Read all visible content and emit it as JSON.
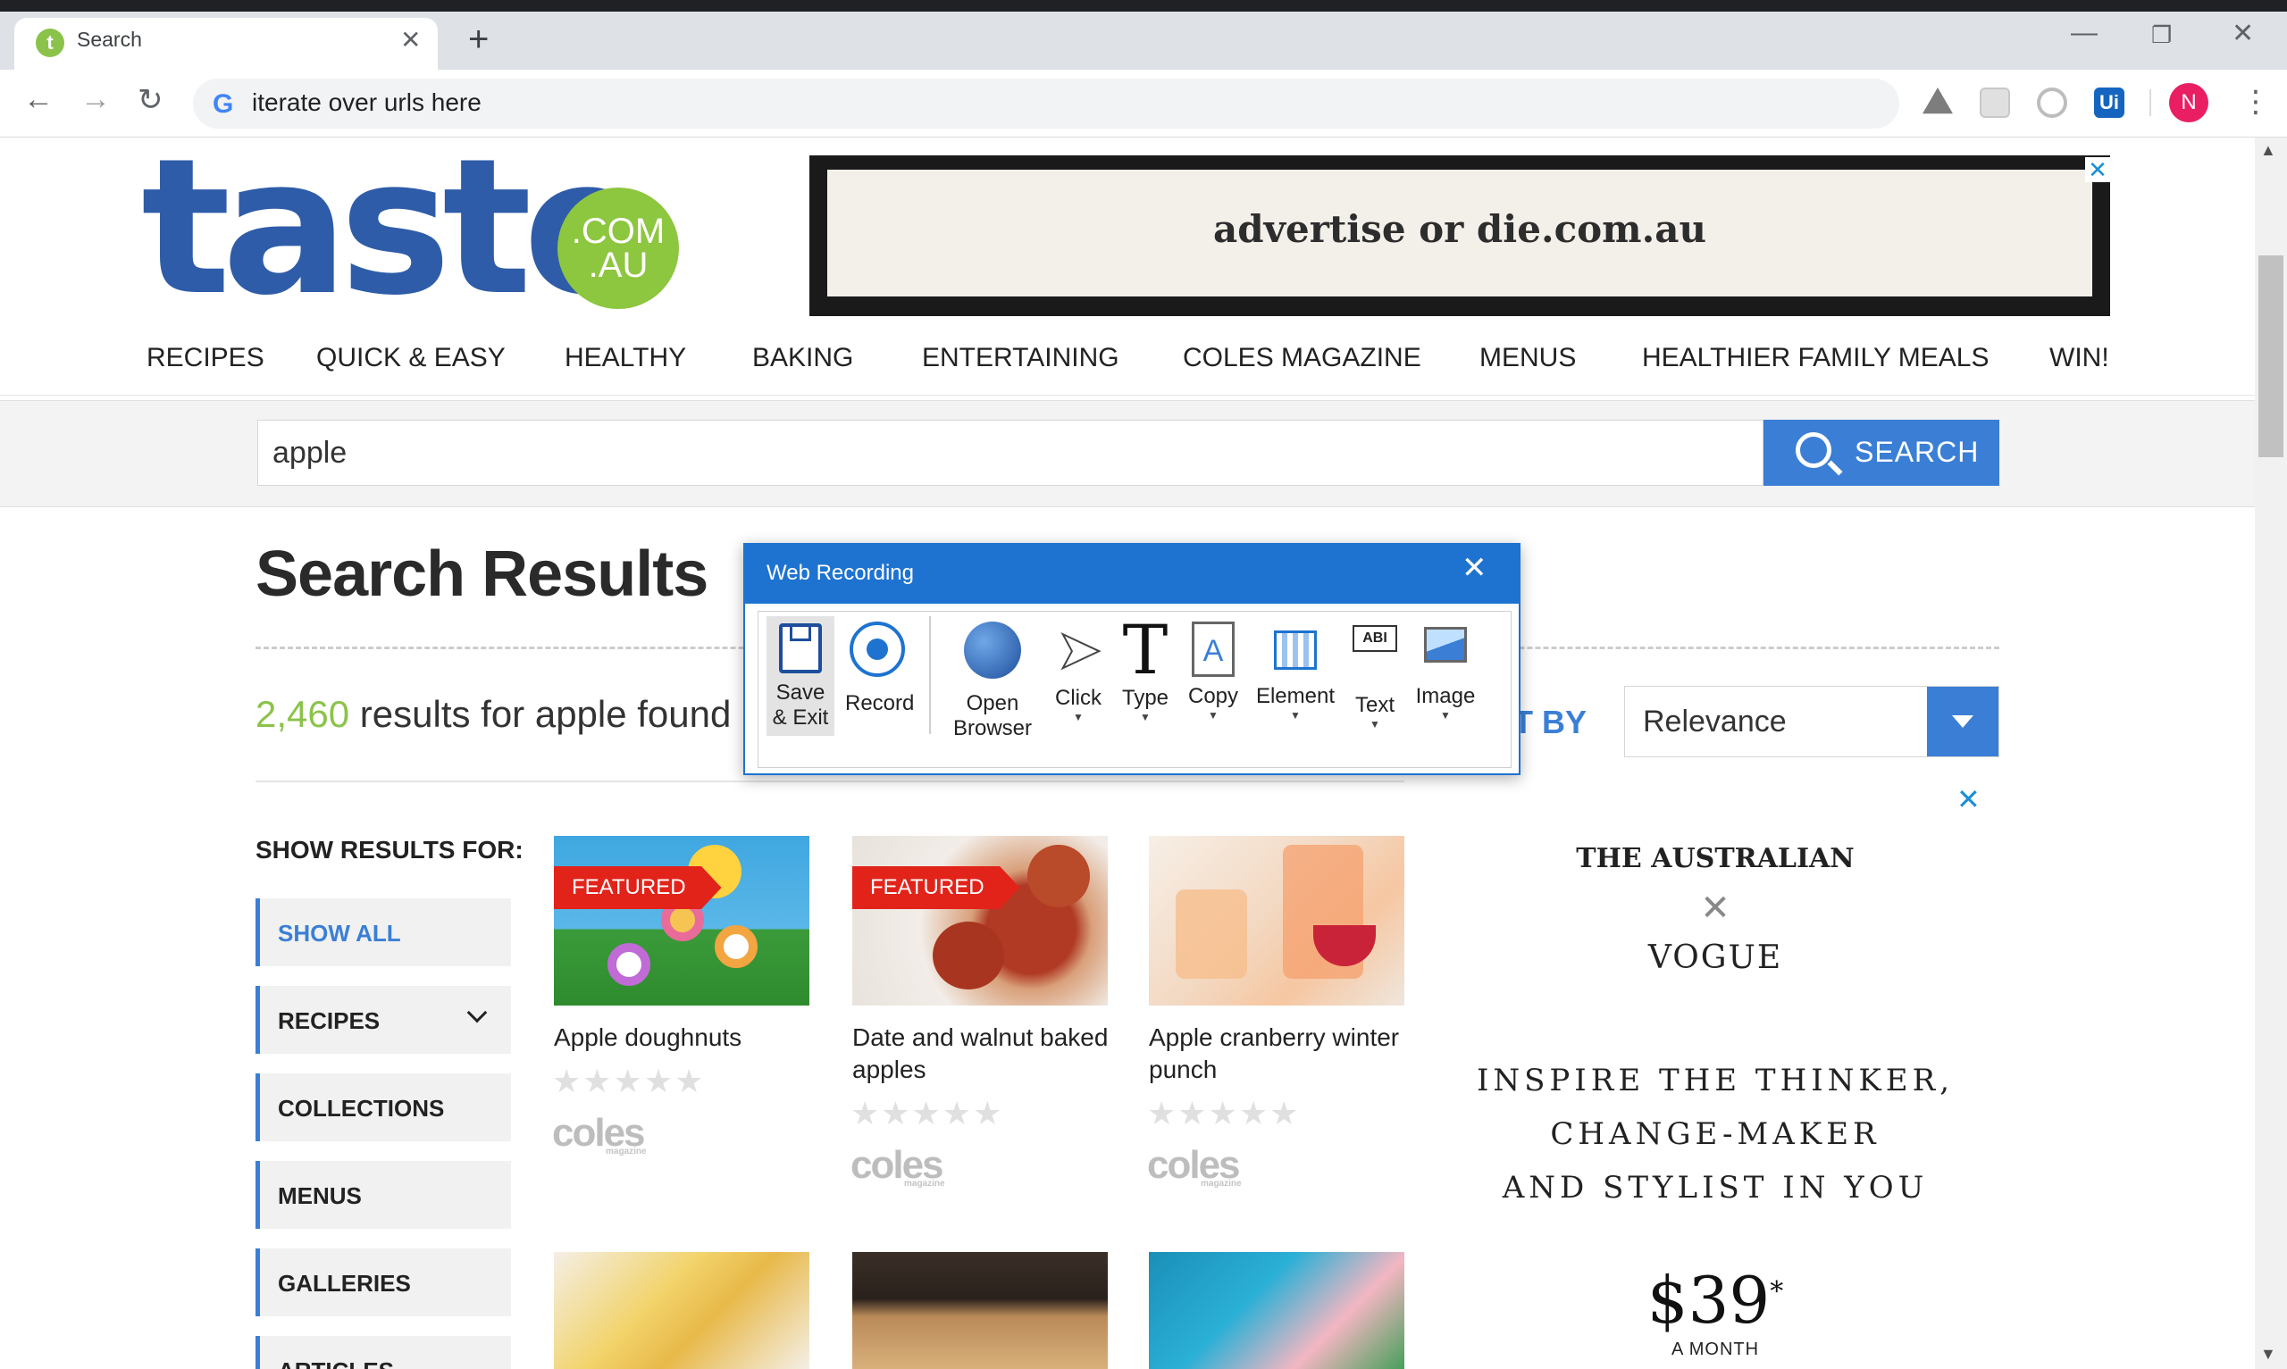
{
  "browser": {
    "tab_title": "Search",
    "tab_icon": "t",
    "url": "iterate over urls here",
    "avatar_initial": "N"
  },
  "site": {
    "logo_word": "taste",
    "logo_domain": ".COM\n.AU",
    "ad_banner_text": "advertise or die.com.au",
    "nav": [
      "RECIPES",
      "QUICK & EASY",
      "HEALTHY",
      "BAKING",
      "ENTERTAINING",
      "COLES MAGAZINE",
      "MENUS",
      "HEALTHIER FAMILY MEALS",
      "WIN!"
    ]
  },
  "search": {
    "value": "apple",
    "button_label": "SEARCH"
  },
  "results": {
    "title": "Search Results",
    "count": "2,460",
    "count_suffix": " results for apple found",
    "sort_label": "T BY",
    "sort_value": "Relevance"
  },
  "filters": {
    "heading": "SHOW RESULTS FOR:",
    "items": [
      "SHOW ALL",
      "RECIPES",
      "COLLECTIONS",
      "MENUS",
      "GALLERIES",
      "ARTICLES"
    ]
  },
  "cards": [
    {
      "title": "Apple doughnuts",
      "badge": "FEATURED",
      "brand": "coles",
      "brand_sub": "magazine"
    },
    {
      "title": "Date and walnut baked apples",
      "badge": "FEATURED",
      "brand": "coles",
      "brand_sub": "magazine"
    },
    {
      "title": "Apple cranberry winter punch",
      "badge": "",
      "brand": "coles",
      "brand_sub": "magazine"
    }
  ],
  "stars": "★★★★★",
  "sidebar_ad": {
    "brand1": "THE AUSTRALIAN",
    "brand2": "VOGUE",
    "line1": "INSPIRE THE THINKER,",
    "line2": "CHANGE-MAKER",
    "line3": "AND STYLIST IN YOU",
    "price": "$39",
    "price_note": "*",
    "period": "A MONTH"
  },
  "recorder": {
    "title": "Web Recording",
    "tools": {
      "save": "Save\n& Exit",
      "record": "Record",
      "open_browser": "Open\nBrowser",
      "click": "Click",
      "type": "Type",
      "copy": "Copy",
      "element": "Element",
      "text": "Text",
      "image": "Image"
    }
  },
  "colors": {
    "brand_blue": "#2e5ca8",
    "brand_green": "#8dc63f",
    "accent_blue": "#3a7fd5",
    "featured_red": "#e2231a",
    "dialog_blue": "#1e73d0"
  }
}
